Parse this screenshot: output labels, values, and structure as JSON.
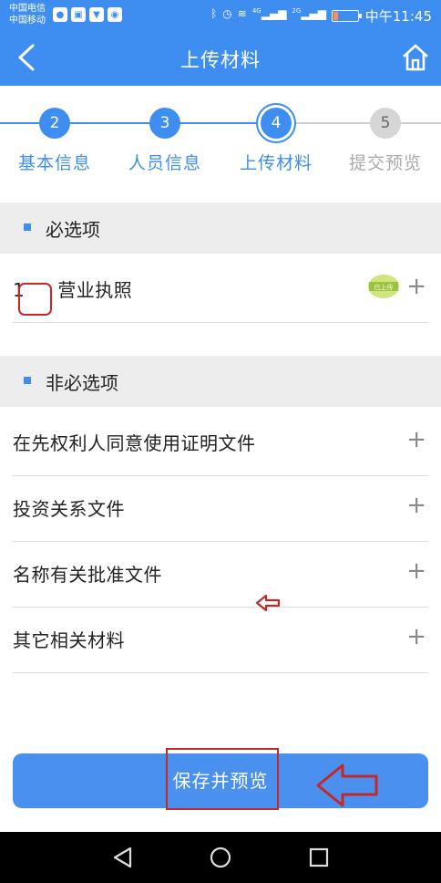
{
  "status": {
    "carrier1": "中国电信",
    "carrier2": "中国移动",
    "network1": "4G",
    "network2": "2G",
    "time": "中午11:45"
  },
  "header": {
    "title": "上传材料"
  },
  "steps": [
    {
      "num": "2",
      "label": "基本信息",
      "state": "done"
    },
    {
      "num": "3",
      "label": "人员信息",
      "state": "done"
    },
    {
      "num": "4",
      "label": "上传材料",
      "state": "current"
    },
    {
      "num": "5",
      "label": "提交预览",
      "state": "todo"
    }
  ],
  "required": {
    "heading": "必选项",
    "items": [
      {
        "prefix": "1",
        "label": "营业执照",
        "badge": "已上传"
      }
    ]
  },
  "optional": {
    "heading": "非必选项",
    "items": [
      {
        "label": "在先权利人同意使用证明文件"
      },
      {
        "label": "投资关系文件"
      },
      {
        "label": "名称有关批准文件"
      },
      {
        "label": "其它相关材料"
      }
    ]
  },
  "plus_symbol": "+",
  "save_button": "保存并预览",
  "colors": {
    "accent": "#3d8ef0",
    "button": "#4a90ee",
    "annotation": "#c62828"
  }
}
